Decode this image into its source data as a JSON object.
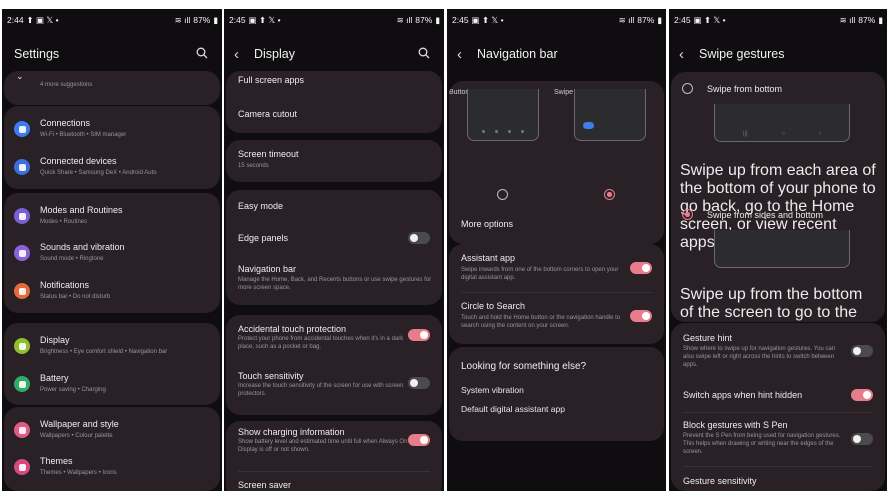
{
  "screens": [
    {
      "status": {
        "time": "2:44",
        "battery": "87%"
      },
      "title": "Settings",
      "items": [
        {
          "title": "",
          "subtitle": "4 more suggestions"
        },
        {
          "title": "Connections",
          "subtitle": "Wi-Fi  •  Bluetooth  •  SIM manager",
          "color": "#3d7bf0"
        },
        {
          "title": "Connected devices",
          "subtitle": "Quick Share  •  Samsung DeX  •  Android Auto",
          "color": "#3b6fe0"
        },
        {
          "title": "Modes and Routines",
          "subtitle": "Modes  •  Routines",
          "color": "#7b5ed6"
        },
        {
          "title": "Sounds and vibration",
          "subtitle": "Sound mode  •  Ringtone",
          "color": "#8a62dd"
        },
        {
          "title": "Notifications",
          "subtitle": "Status bar  •  Do not disturb",
          "color": "#e56a3a"
        },
        {
          "title": "Display",
          "subtitle": "Brightness  •  Eye comfort shield  •  Navigation bar",
          "color": "#8fbf2c"
        },
        {
          "title": "Battery",
          "subtitle": "Power saving  •  Charging",
          "color": "#2fae63"
        },
        {
          "title": "Wallpaper and style",
          "subtitle": "Wallpapers  •  Colour palette",
          "color": "#e25b86"
        },
        {
          "title": "Themes",
          "subtitle": "Themes  •  Wallpapers  •  Icons",
          "color": "#d9487a"
        }
      ]
    },
    {
      "status": {
        "time": "2:45",
        "battery": "87%"
      },
      "title": "Display",
      "items": [
        {
          "title": "Full screen apps"
        },
        {
          "title": "Camera cutout"
        },
        {
          "title": "Screen timeout",
          "subtitle": "15 seconds"
        },
        {
          "title": "Easy mode"
        },
        {
          "title": "Edge panels"
        },
        {
          "title": "Navigation bar",
          "subtitle": "Manage the Home, Back, and Recents buttons or use swipe gestures for more screen space."
        },
        {
          "title": "Accidental touch protection",
          "subtitle": "Protect your phone from accidental touches when it's in a dark place, such as a pocket or bag."
        },
        {
          "title": "Touch sensitivity",
          "subtitle": "Increase the touch sensitivity of the screen for use with screen protectors."
        },
        {
          "title": "Show charging information",
          "subtitle": "Show battery level and estimated time until full when Always On Display is off or not shown."
        },
        {
          "title": "Screen saver"
        }
      ]
    },
    {
      "status": {
        "time": "2:45",
        "battery": "87%"
      },
      "title": "Navigation bar",
      "options": [
        {
          "label": "Buttons"
        },
        {
          "label": "Swipe gestures"
        }
      ],
      "more_options": "More options",
      "items": [
        {
          "title": "Assistant app",
          "subtitle": "Swipe inwards from one of the bottom corners to open your digital assistant app."
        },
        {
          "title": "Circle to Search",
          "subtitle": "Touch and hold the Home button or the navigation handle to search using the content on your screen."
        }
      ],
      "looking": {
        "title": "Looking for something else?",
        "links": [
          "System vibration",
          "Default digital assistant app"
        ]
      }
    },
    {
      "status": {
        "time": "2:45",
        "battery": "87%"
      },
      "title": "Swipe gestures",
      "options": [
        {
          "title": "Swipe from bottom",
          "subtitle": "Swipe up from each area of the bottom of your phone to go back, go to the Home screen, or view recent apps."
        },
        {
          "title": "Swipe from sides and bottom",
          "subtitle": "Swipe up from the bottom of the screen to go to the Home screen."
        }
      ],
      "items": [
        {
          "title": "Gesture hint",
          "subtitle": "Show where to swipe up for navigation gestures. You can also swipe left or right across the hints to switch between apps."
        },
        {
          "title": "Switch apps when hint hidden"
        },
        {
          "title": "Block gestures with S Pen",
          "subtitle": "Prevent the S Pen from being used for navigation gestures. This helps when drawing or writing near the edges of the screen."
        },
        {
          "title": "Gesture sensitivity"
        }
      ]
    }
  ],
  "colors": {
    "accent": "#e77d8a",
    "card": "#2a2126",
    "background": "#0f0d0f"
  }
}
